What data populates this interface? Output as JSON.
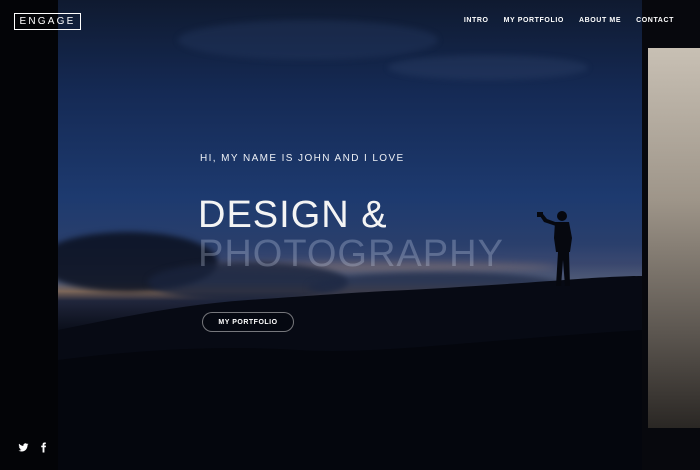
{
  "brand": {
    "logo_text": "ENGAGE"
  },
  "nav": {
    "items": [
      {
        "label": "INTRO"
      },
      {
        "label": "MY PORTFOLIO"
      },
      {
        "label": "ABOUT ME"
      },
      {
        "label": "CONTACT"
      }
    ]
  },
  "hero": {
    "intro": "HI, MY NAME IS JOHN AND I LOVE",
    "title_line1": "DESIGN &",
    "title_line2": "PHOTOGRAPHY",
    "cta_label": "MY PORTFOLIO"
  },
  "social": {
    "icons": [
      "twitter-icon",
      "facebook-icon"
    ]
  },
  "colors": {
    "sky_top": "#0f1a30",
    "sky_mid": "#1d3a6f",
    "horizon": "#9a7f6e",
    "text": "#ffffff"
  }
}
